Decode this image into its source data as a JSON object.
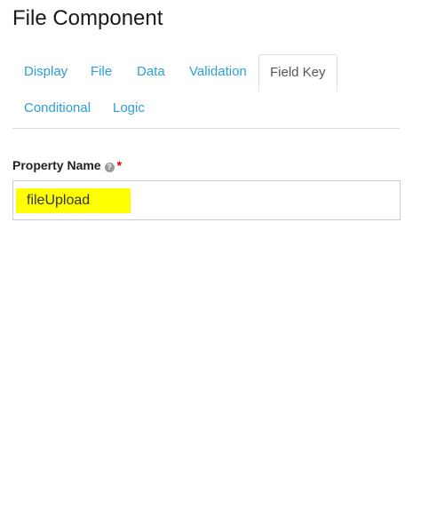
{
  "page": {
    "title": "File Component"
  },
  "tabs": [
    {
      "label": "Display",
      "active": false
    },
    {
      "label": "File",
      "active": false
    },
    {
      "label": "Data",
      "active": false
    },
    {
      "label": "Validation",
      "active": false
    },
    {
      "label": "Field Key",
      "active": true
    },
    {
      "label": "Conditional",
      "active": false
    },
    {
      "label": "Logic",
      "active": false
    }
  ],
  "form": {
    "property_name": {
      "label": "Property Name",
      "help_icon": "question-circle-icon",
      "required_marker": "*",
      "value": "fileUpload",
      "highlight_color": "#ffff00"
    }
  },
  "colors": {
    "link": "#2a9fd6",
    "active_tab_text": "#555555",
    "required": "#cc0000"
  }
}
